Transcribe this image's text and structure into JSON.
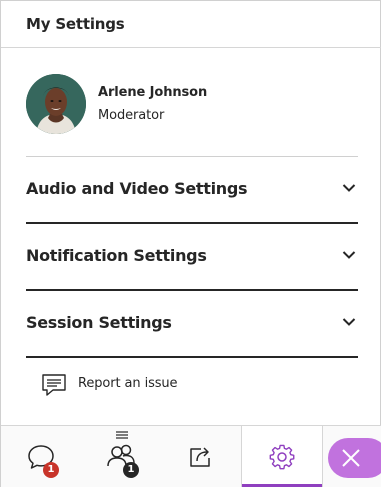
{
  "header": {
    "title": "My Settings"
  },
  "profile": {
    "name": "Arlene Johnson",
    "role": "Moderator"
  },
  "sections": [
    {
      "label": "Audio and Video Settings"
    },
    {
      "label": "Notification Settings"
    },
    {
      "label": "Session Settings"
    }
  ],
  "report": {
    "label": "Report an issue"
  },
  "tabbar": {
    "chat_badge": "1",
    "attendees_badge": "1",
    "active_tab": "settings",
    "icons": [
      "chat-icon",
      "attendees-icon",
      "share-content-icon",
      "gear-icon",
      "close-icon"
    ]
  },
  "colors": {
    "accent": "#8f3fbf",
    "close_button": "#c172de",
    "badge_red": "#c8342a",
    "text": "#262626"
  }
}
